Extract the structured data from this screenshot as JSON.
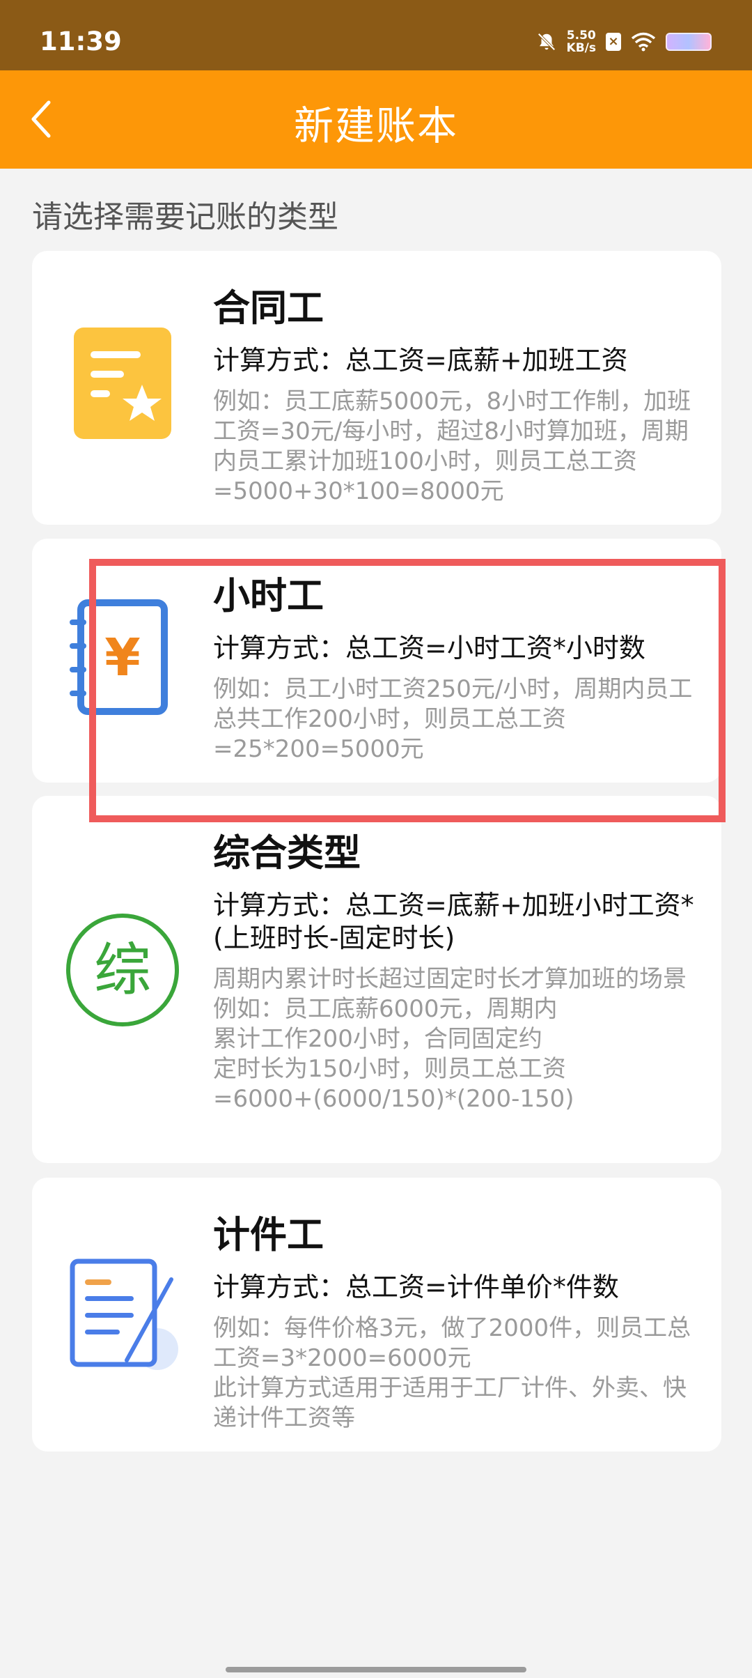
{
  "status_bar": {
    "time": "11:39",
    "net_speed_value": "5.50",
    "net_speed_unit": "KB/s"
  },
  "header": {
    "title": "新建账本",
    "back_icon": "chevron-left-icon"
  },
  "prompt": "请选择需要记账的类型",
  "cards": [
    {
      "title": "合同工",
      "formula": "计算方式：总工资=底薪+加班工资",
      "example": "例如：员工底薪5000元，8小时工作制，加班工资=30元/每小时，超过8小时算加班，周期内员工累计加班100小时，则员工总工资=5000+30*100=8000元",
      "icon": "document-star-icon"
    },
    {
      "title": "小时工",
      "formula": "计算方式：总工资=小时工资*小时数",
      "example": "例如：员工小时工资250元/小时，周期内员工总共工作200小时，则员工总工资=25*200=5000元",
      "icon": "yuan-notebook-icon"
    },
    {
      "title": "综合类型",
      "formula": "计算方式：总工资=底薪+加班小时工资*(上班时长-固定时长)",
      "example": "周期内累计时长超过固定时长才算加班的场景\n例如：员工底薪6000元，周期内\n累计工作200小时，合同固定约\n定时长为150小时，则员工总工资\n=6000+(6000/150)*(200-150)",
      "icon": "zong-circle-icon",
      "icon_char": "综"
    },
    {
      "title": "计件工",
      "formula": "计算方式：总工资=计件单价*件数",
      "example": "例如：每件价格3元，做了2000件，则员工总工资=3*2000=6000元\n此计算方式适用于适用于工厂计件、外卖、快递计件工资等",
      "icon": "document-pen-icon"
    }
  ],
  "colors": {
    "status_bar": "#8b5a16",
    "app_bar": "#fd9708",
    "highlight": "#ef5b5b",
    "card_bg": "#ffffff",
    "page_bg": "#f3f3f3"
  }
}
